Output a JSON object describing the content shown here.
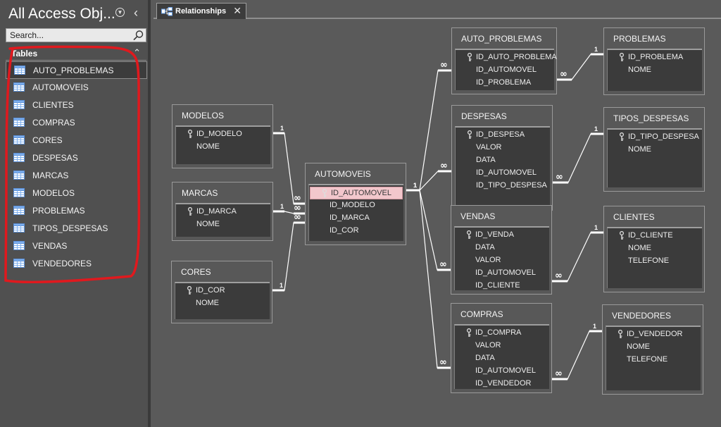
{
  "nav": {
    "title": "All Access Obj...",
    "title_dropdown_icon": "dropdown-circle-icon",
    "collapse_icon": "chevron-left-icon",
    "search_placeholder": "Search...",
    "search_icon": "search-icon",
    "group_label": "Tables",
    "group_chevron_icon": "chevron-up-icon",
    "items": [
      {
        "label": "AUTO_PROBLEMAS",
        "selected": true
      },
      {
        "label": "AUTOMOVEIS"
      },
      {
        "label": "CLIENTES"
      },
      {
        "label": "COMPRAS"
      },
      {
        "label": "CORES"
      },
      {
        "label": "DESPESAS"
      },
      {
        "label": "MARCAS"
      },
      {
        "label": "MODELOS"
      },
      {
        "label": "PROBLEMAS"
      },
      {
        "label": "TIPOS_DESPESAS"
      },
      {
        "label": "VENDAS"
      },
      {
        "label": "VENDEDORES"
      }
    ],
    "annotation_color": "#e0191e"
  },
  "tab": {
    "label": "Relationships",
    "icon": "relationships-icon",
    "close_icon": "close-icon"
  },
  "tables": {
    "modelos": {
      "title": "MODELOS",
      "fields": [
        {
          "name": "ID_MODELO",
          "key": true
        },
        {
          "name": "NOME"
        }
      ]
    },
    "marcas": {
      "title": "MARCAS",
      "fields": [
        {
          "name": "ID_MARCA",
          "key": true
        },
        {
          "name": "NOME"
        }
      ]
    },
    "cores": {
      "title": "CORES",
      "fields": [
        {
          "name": "ID_COR",
          "key": true
        },
        {
          "name": "NOME"
        }
      ]
    },
    "automoveis": {
      "title": "AUTOMOVEIS",
      "fields": [
        {
          "name": "ID_AUTOMOVEL",
          "key": true,
          "highlighted": true
        },
        {
          "name": "ID_MODELO"
        },
        {
          "name": "ID_MARCA"
        },
        {
          "name": "ID_COR"
        }
      ]
    },
    "auto_problemas": {
      "title": "AUTO_PROBLEMAS",
      "fields": [
        {
          "name": "ID_AUTO_PROBLEMA",
          "key": true
        },
        {
          "name": "ID_AUTOMOVEL"
        },
        {
          "name": "ID_PROBLEMA"
        }
      ]
    },
    "despesas": {
      "title": "DESPESAS",
      "fields": [
        {
          "name": "ID_DESPESA",
          "key": true
        },
        {
          "name": "VALOR"
        },
        {
          "name": "DATA"
        },
        {
          "name": "ID_AUTOMOVEL"
        },
        {
          "name": "ID_TIPO_DESPESA"
        }
      ]
    },
    "vendas": {
      "title": "VENDAS",
      "fields": [
        {
          "name": "ID_VENDA",
          "key": true
        },
        {
          "name": "DATA"
        },
        {
          "name": "VALOR"
        },
        {
          "name": "ID_AUTOMOVEL"
        },
        {
          "name": "ID_CLIENTE"
        }
      ]
    },
    "compras": {
      "title": "COMPRAS",
      "fields": [
        {
          "name": "ID_COMPRA",
          "key": true
        },
        {
          "name": "VALOR"
        },
        {
          "name": "DATA"
        },
        {
          "name": "ID_AUTOMOVEL"
        },
        {
          "name": "ID_VENDEDOR"
        }
      ]
    },
    "problemas": {
      "title": "PROBLEMAS",
      "fields": [
        {
          "name": "ID_PROBLEMA",
          "key": true
        },
        {
          "name": "NOME"
        }
      ]
    },
    "tipos_despesas": {
      "title": "TIPOS_DESPESAS",
      "fields": [
        {
          "name": "ID_TIPO_DESPESA",
          "key": true
        },
        {
          "name": "NOME"
        }
      ]
    },
    "clientes": {
      "title": "CLIENTES",
      "fields": [
        {
          "name": "ID_CLIENTE",
          "key": true
        },
        {
          "name": "NOME"
        },
        {
          "name": "TELEFONE"
        }
      ]
    },
    "vendedores": {
      "title": "VENDEDORES",
      "fields": [
        {
          "name": "ID_VENDEDOR",
          "key": true
        },
        {
          "name": "NOME"
        },
        {
          "name": "TELEFONE"
        }
      ]
    }
  },
  "relationships": [
    {
      "one": "modelos",
      "many": "automoveis",
      "one_label": "1",
      "many_label": "∞"
    },
    {
      "one": "marcas",
      "many": "automoveis",
      "one_label": "1",
      "many_label": "∞"
    },
    {
      "one": "cores",
      "many": "automoveis",
      "one_label": "1",
      "many_label": "∞"
    },
    {
      "one": "automoveis",
      "many": "auto_problemas",
      "one_label": "1",
      "many_label": "∞"
    },
    {
      "one": "automoveis",
      "many": "despesas",
      "one_label": "1",
      "many_label": "∞"
    },
    {
      "one": "automoveis",
      "many": "vendas",
      "one_label": "1",
      "many_label": "∞"
    },
    {
      "one": "automoveis",
      "many": "compras",
      "one_label": "1",
      "many_label": "∞"
    },
    {
      "one": "problemas",
      "many": "auto_problemas",
      "one_label": "1",
      "many_label": "∞"
    },
    {
      "one": "tipos_despesas",
      "many": "despesas",
      "one_label": "1",
      "many_label": "∞"
    },
    {
      "one": "clientes",
      "many": "vendas",
      "one_label": "1",
      "many_label": "∞"
    },
    {
      "one": "vendedores",
      "many": "compras",
      "one_label": "1",
      "many_label": "∞"
    }
  ],
  "colors": {
    "canvas": "#5a5a5a",
    "highlight": "#f2c7cc",
    "line": "#ffffff"
  }
}
